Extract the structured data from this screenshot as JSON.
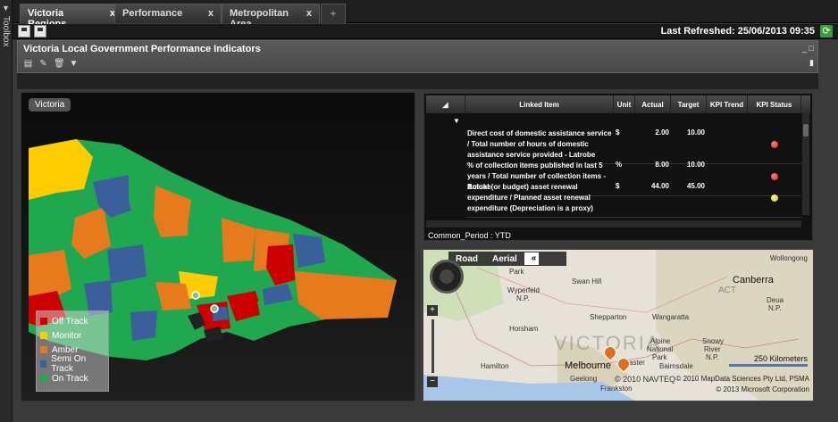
{
  "toolbox": {
    "label": "Toolbox"
  },
  "tabs": [
    {
      "label": "Victoria Regions",
      "close": "x"
    },
    {
      "label": "Performance",
      "close": "x"
    },
    {
      "label": "Metropolitan Area",
      "close": "x"
    }
  ],
  "tab_add": "+",
  "topbar": {
    "last_refreshed": "Last Refreshed: 25/06/2013 09:35"
  },
  "panel": {
    "title": "Victoria Local Government Performance Indicators"
  },
  "map_view": {
    "region_label": "Victoria"
  },
  "legend": [
    {
      "label": "Off Track",
      "color": "#cc0000"
    },
    {
      "label": "Monitor",
      "color": "#ffcc00"
    },
    {
      "label": "Amber",
      "color": "#e87a1e"
    },
    {
      "label": "Semi On Track",
      "color": "#3b5f9a"
    },
    {
      "label": "On Track",
      "color": "#1fa84f"
    }
  ],
  "table": {
    "headers": [
      "Linked Item",
      "Unit",
      "Actual",
      "Target",
      "KPI Trend",
      "KPI Status"
    ],
    "rows": [
      {
        "item": "Direct cost of domestic assistance service / Total number of hours of domestic assistance service provided - Latrobe",
        "unit": "$",
        "actual": "2.00",
        "target": "10.00",
        "status_color": "#e02020"
      },
      {
        "item": "% of collection items published in last 5 years / Total number of collection items -Buloke",
        "unit": "%",
        "actual": "8.00",
        "target": "10.00",
        "status_color": "#e02020"
      },
      {
        "item": "Actual (or budget) asset renewal expenditure / Planned asset renewal expenditure (Depreciation is a proxy)",
        "unit": "$",
        "actual": "44.00",
        "target": "45.00",
        "status_color": "#d4cc10"
      }
    ],
    "period": "Common_Period : YTD"
  },
  "bing_map": {
    "modes": [
      "Road",
      "Aerial"
    ],
    "collapse": "«",
    "labels": {
      "park": "Park",
      "wyperfeld": "Wyperfeld",
      "np": "N.P.",
      "swan_hill": "Swan Hill",
      "canberra": "Canberra",
      "act": "ACT",
      "deua": "Deua",
      "deua_np": "N.P.",
      "wollongong": "Wollongong",
      "shepparton": "Shepparton",
      "wangaratta": "Wangaratta",
      "horsham": "Horsham",
      "victoria": "VICTORIA",
      "alpine": "Alpine",
      "national": "National",
      "park2": "Park",
      "snowy": "Snowy",
      "river": "River",
      "snowy_np": "N.P.",
      "hamilton": "Hamilton",
      "melbourne": "Melbourne",
      "bairnsdale": "Bairnsdale",
      "geelong": "Geelong",
      "frankston": "Frankston",
      "navteq": "© 2010 NAVTEQ",
      "aster": "aster"
    },
    "scale": "250 Kilometers",
    "credit1": "© 2010 MapData Sciences Pty Ltd, PSMA",
    "credit2": "© 2013 Microsoft Corporation"
  }
}
